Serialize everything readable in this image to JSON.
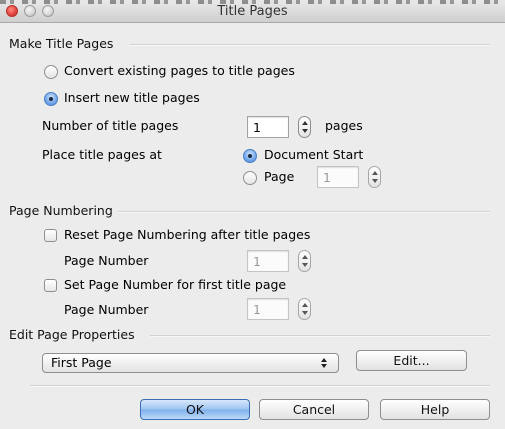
{
  "window": {
    "title": "Title Pages"
  },
  "make_title_pages": {
    "heading": "Make Title Pages",
    "convert_label": "Convert existing pages to title pages",
    "convert_selected": false,
    "insert_label": "Insert new title pages",
    "insert_selected": true,
    "number_label": "Number of title pages",
    "number_value": "1",
    "pages_suffix": "pages",
    "place_label": "Place title pages at",
    "doc_start_label": "Document Start",
    "doc_start_selected": true,
    "page_option_label": "Page",
    "page_option_selected": false,
    "page_value": "1"
  },
  "page_numbering": {
    "heading": "Page Numbering",
    "reset_label": "Reset Page Numbering after title pages",
    "reset_checked": false,
    "reset_page_number_label": "Page Number",
    "reset_page_number_value": "1",
    "set_label": "Set Page Number for first title page",
    "set_checked": false,
    "set_page_number_label": "Page Number",
    "set_page_number_value": "1"
  },
  "edit_page_properties": {
    "heading": "Edit Page Properties",
    "selected_page": "First Page",
    "edit_button": "Edit..."
  },
  "footer": {
    "ok": "OK",
    "cancel": "Cancel",
    "help": "Help"
  },
  "colors": {
    "window_bg": "#ececec",
    "default_button": "#8fbaf0",
    "close_button": "#e0443e"
  }
}
